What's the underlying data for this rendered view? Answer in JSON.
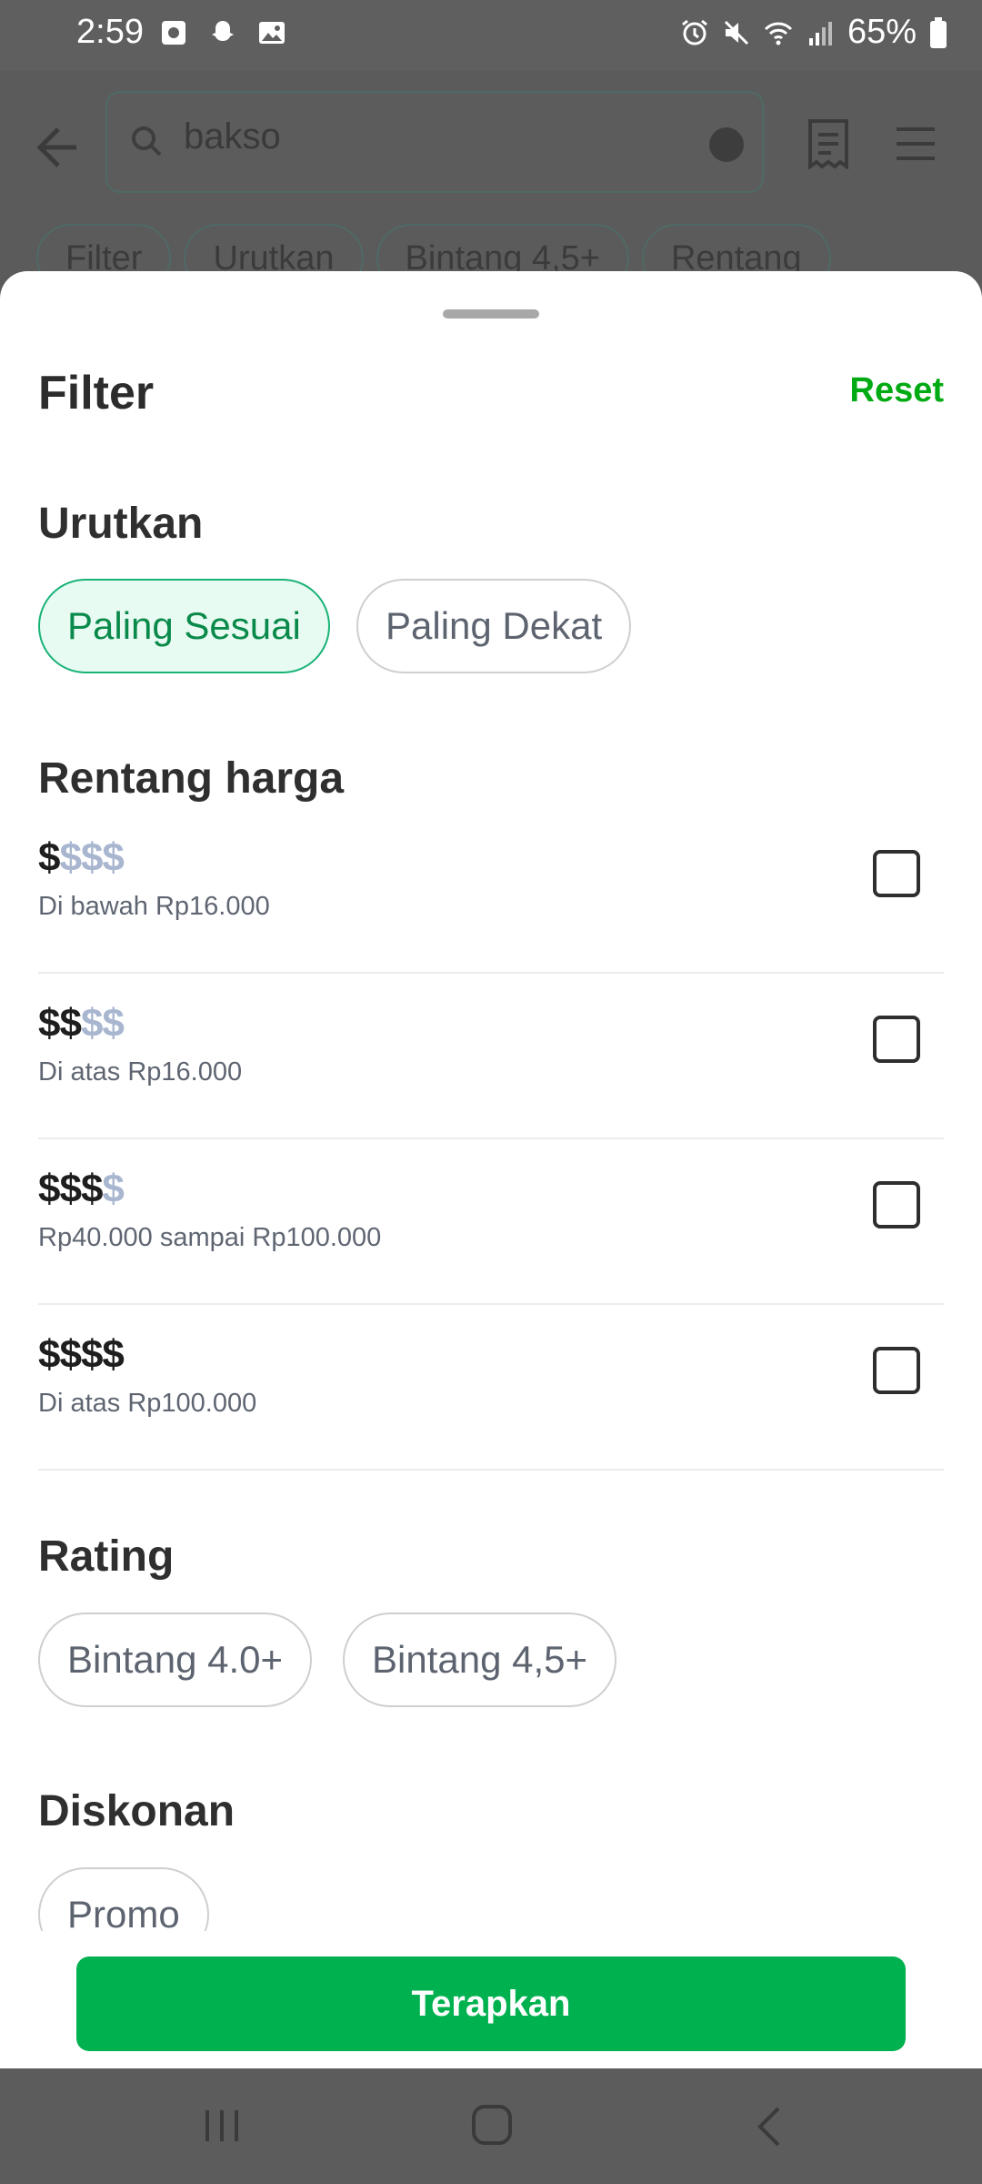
{
  "status_bar": {
    "time": "2:59",
    "battery": "65%",
    "icons": [
      "screenshot-icon",
      "snapchat-icon",
      "gallery-icon",
      "alarm-icon",
      "mute-icon",
      "wifi-icon",
      "signal-icon",
      "battery-icon"
    ]
  },
  "background_app": {
    "search_value": "bakso",
    "chips": [
      "Filter",
      "Urutkan",
      "Bintang 4,5+",
      "Rentang"
    ]
  },
  "sheet": {
    "title": "Filter",
    "reset_label": "Reset",
    "sort": {
      "title": "Urutkan",
      "options": [
        {
          "label": "Paling Sesuai",
          "selected": true
        },
        {
          "label": "Paling Dekat",
          "selected": false
        }
      ]
    },
    "price": {
      "title": "Rentang harga",
      "options": [
        {
          "active": "$",
          "inactive": "$$$",
          "desc": "Di bawah Rp16.000",
          "checked": false
        },
        {
          "active": "$$",
          "inactive": "$$",
          "desc": "Di atas Rp16.000",
          "checked": false
        },
        {
          "active": "$$$",
          "inactive": "$",
          "desc": "Rp40.000 sampai Rp100.000",
          "checked": false
        },
        {
          "active": "$$$$",
          "inactive": "",
          "desc": "Di atas Rp100.000",
          "checked": false
        }
      ]
    },
    "rating": {
      "title": "Rating",
      "options": [
        "Bintang 4.0+",
        "Bintang 4,5+"
      ]
    },
    "discount": {
      "title": "Diskonan",
      "options": [
        "Promo"
      ]
    },
    "apply_label": "Terapkan"
  },
  "colors": {
    "accent_green": "#00aa13",
    "button_green": "#00b14f",
    "selected_chip_bg": "#e7fbf2",
    "selected_chip_border": "#19b376"
  }
}
